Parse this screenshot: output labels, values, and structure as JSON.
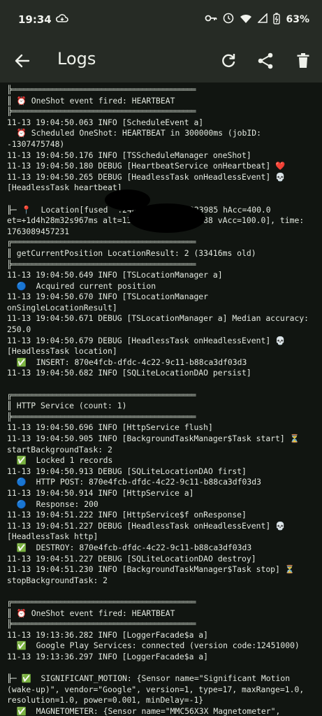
{
  "status_bar": {
    "time": "19:34",
    "battery": "63%",
    "icons": [
      "cloud-sync-icon",
      "key-icon",
      "alarm-icon",
      "wifi-icon",
      "signal-icon",
      "battery-icon"
    ]
  },
  "app_bar": {
    "title": "Logs",
    "icons": [
      "back-arrow-icon",
      "refresh-icon",
      "share-icon",
      "delete-icon"
    ]
  },
  "log_lines": [
    "╠═════════════════════════════════════════════",
    "║ ⏰ OneShot event fired: HEARTBEAT",
    "╠═════════════════════════════════════════════",
    "11-13 19:04:50.063 INFO [ScheduleEvent a]",
    "  ⏰ Scheduled OneShot: HEARTBEAT in 300000ms (jobID:",
    "-1307475748)",
    "11-13 19:04:50.176 INFO [TSScheduleManager oneShot]",
    "11-13 19:04:50.180 DEBUG [HeartbeatService onHeartbeat] ❤️",
    "11-13 19:04:50.265 DEBUG [HeadlessTask onHeadlessEvent] 💀",
    "[HeadlessTask heartbeat]",
    "",
    "╟─ 📍  Location[fused  .248706,      .223985 hAcc=400.0",
    "et=+1d4h28m32s967ms alt=13.              88 vAcc=100.0], time:",
    "1763089457231",
    "╔═════════════════════════════════════════════",
    "║ getCurrentPosition LocationResult: 2 (33416ms old)",
    "╠═════════════════════════════════════════════",
    "11-13 19:04:50.649 INFO [TSLocationManager a]",
    "  🔵  Acquired current position",
    "11-13 19:04:50.670 INFO [TSLocationManager",
    "onSingleLocationResult]",
    "11-13 19:04:50.671 DEBUG [TSLocationManager a] Median accuracy:",
    "250.0",
    "11-13 19:04:50.679 DEBUG [HeadlessTask onHeadlessEvent] 💀",
    "[HeadlessTask location]",
    "  ✅  INSERT: 870e4fcb-dfdc-4c22-9c11-b88ca3df03d3",
    "11-13 19:04:50.682 INFO [SQLiteLocationDAO persist]",
    "",
    "╔═════════════════════════════════════════════",
    "║ HTTP Service (count: 1)",
    "╠═════════════════════════════════════════════",
    "11-13 19:04:50.696 INFO [HttpService flush]",
    "11-13 19:04:50.905 INFO [BackgroundTaskManager$Task start] ⏳",
    "startBackgroundTask: 2",
    "  ✅  Locked 1 records",
    "11-13 19:04:50.913 DEBUG [SQLiteLocationDAO first]",
    "  🔵  HTTP POST: 870e4fcb-dfdc-4c22-9c11-b88ca3df03d3",
    "11-13 19:04:50.914 INFO [HttpService a]",
    "  🔵  Response: 200",
    "11-13 19:04:51.222 INFO [HttpService$f onResponse]",
    "11-13 19:04:51.227 DEBUG [HeadlessTask onHeadlessEvent] 💀",
    "[HeadlessTask http]",
    "  ✅  DESTROY: 870e4fcb-dfdc-4c22-9c11-b88ca3df03d3",
    "11-13 19:04:51.227 DEBUG [SQLiteLocationDAO destroy]",
    "11-13 19:04:51.230 INFO [BackgroundTaskManager$Task stop] ⏳",
    "stopBackgroundTask: 2",
    "",
    "╔═════════════════════════════════════════════",
    "║ ⏰ OneShot event fired: HEARTBEAT",
    "╠═════════════════════════════════════════════",
    "11-13 19:13:36.282 INFO [LoggerFacade$a a]",
    "  ✅  Google Play Services: connected (version code:12451000)",
    "11-13 19:13:36.297 INFO [LoggerFacade$a a]",
    "",
    "╟─ ✅  SIGNIFICANT_MOTION: {Sensor name=\"Significant Motion",
    "(wake-up)\", vendor=\"Google\", version=1, type=17, maxRange=1.0,",
    "resolution=1.0, power=0.001, minDelay=-1}",
    "  ✅  MAGNETOMETER: {Sensor name=\"MMC56X3X Magnetometer\","
  ]
}
